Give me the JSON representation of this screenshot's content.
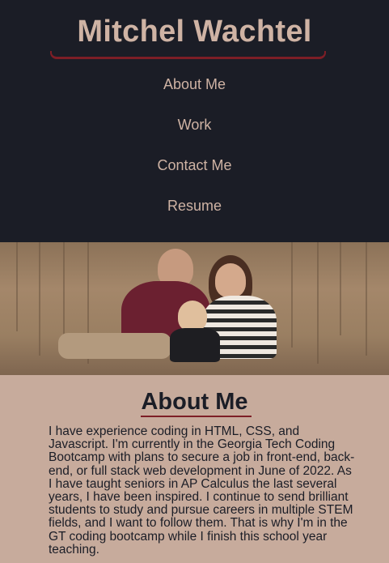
{
  "header": {
    "title": "Mitchel Wachtel",
    "nav": [
      "About Me",
      "Work",
      "Contact Me",
      "Resume"
    ]
  },
  "photo": {
    "alt_icon": "family-photo"
  },
  "about": {
    "heading": "About Me",
    "body": "I have experience coding in HTML, CSS, and Javascript. I'm currently in the Georgia Tech Coding Bootcamp with plans to secure a job in front-end, back-end, or full stack web development in June of 2022. As I have taught seniors in AP Calculus the last several years, I have been inspired. I continue to send brilliant students to study and pursue careers in multiple STEM fields, and I want to follow them. That is why I'm in the GT coding bootcamp while I finish this school year teaching."
  },
  "colors": {
    "header_bg": "#1b1d26",
    "accent_text": "#cfb3a4",
    "underline": "#7d1e26",
    "page_bg": "#c7ab9c"
  }
}
